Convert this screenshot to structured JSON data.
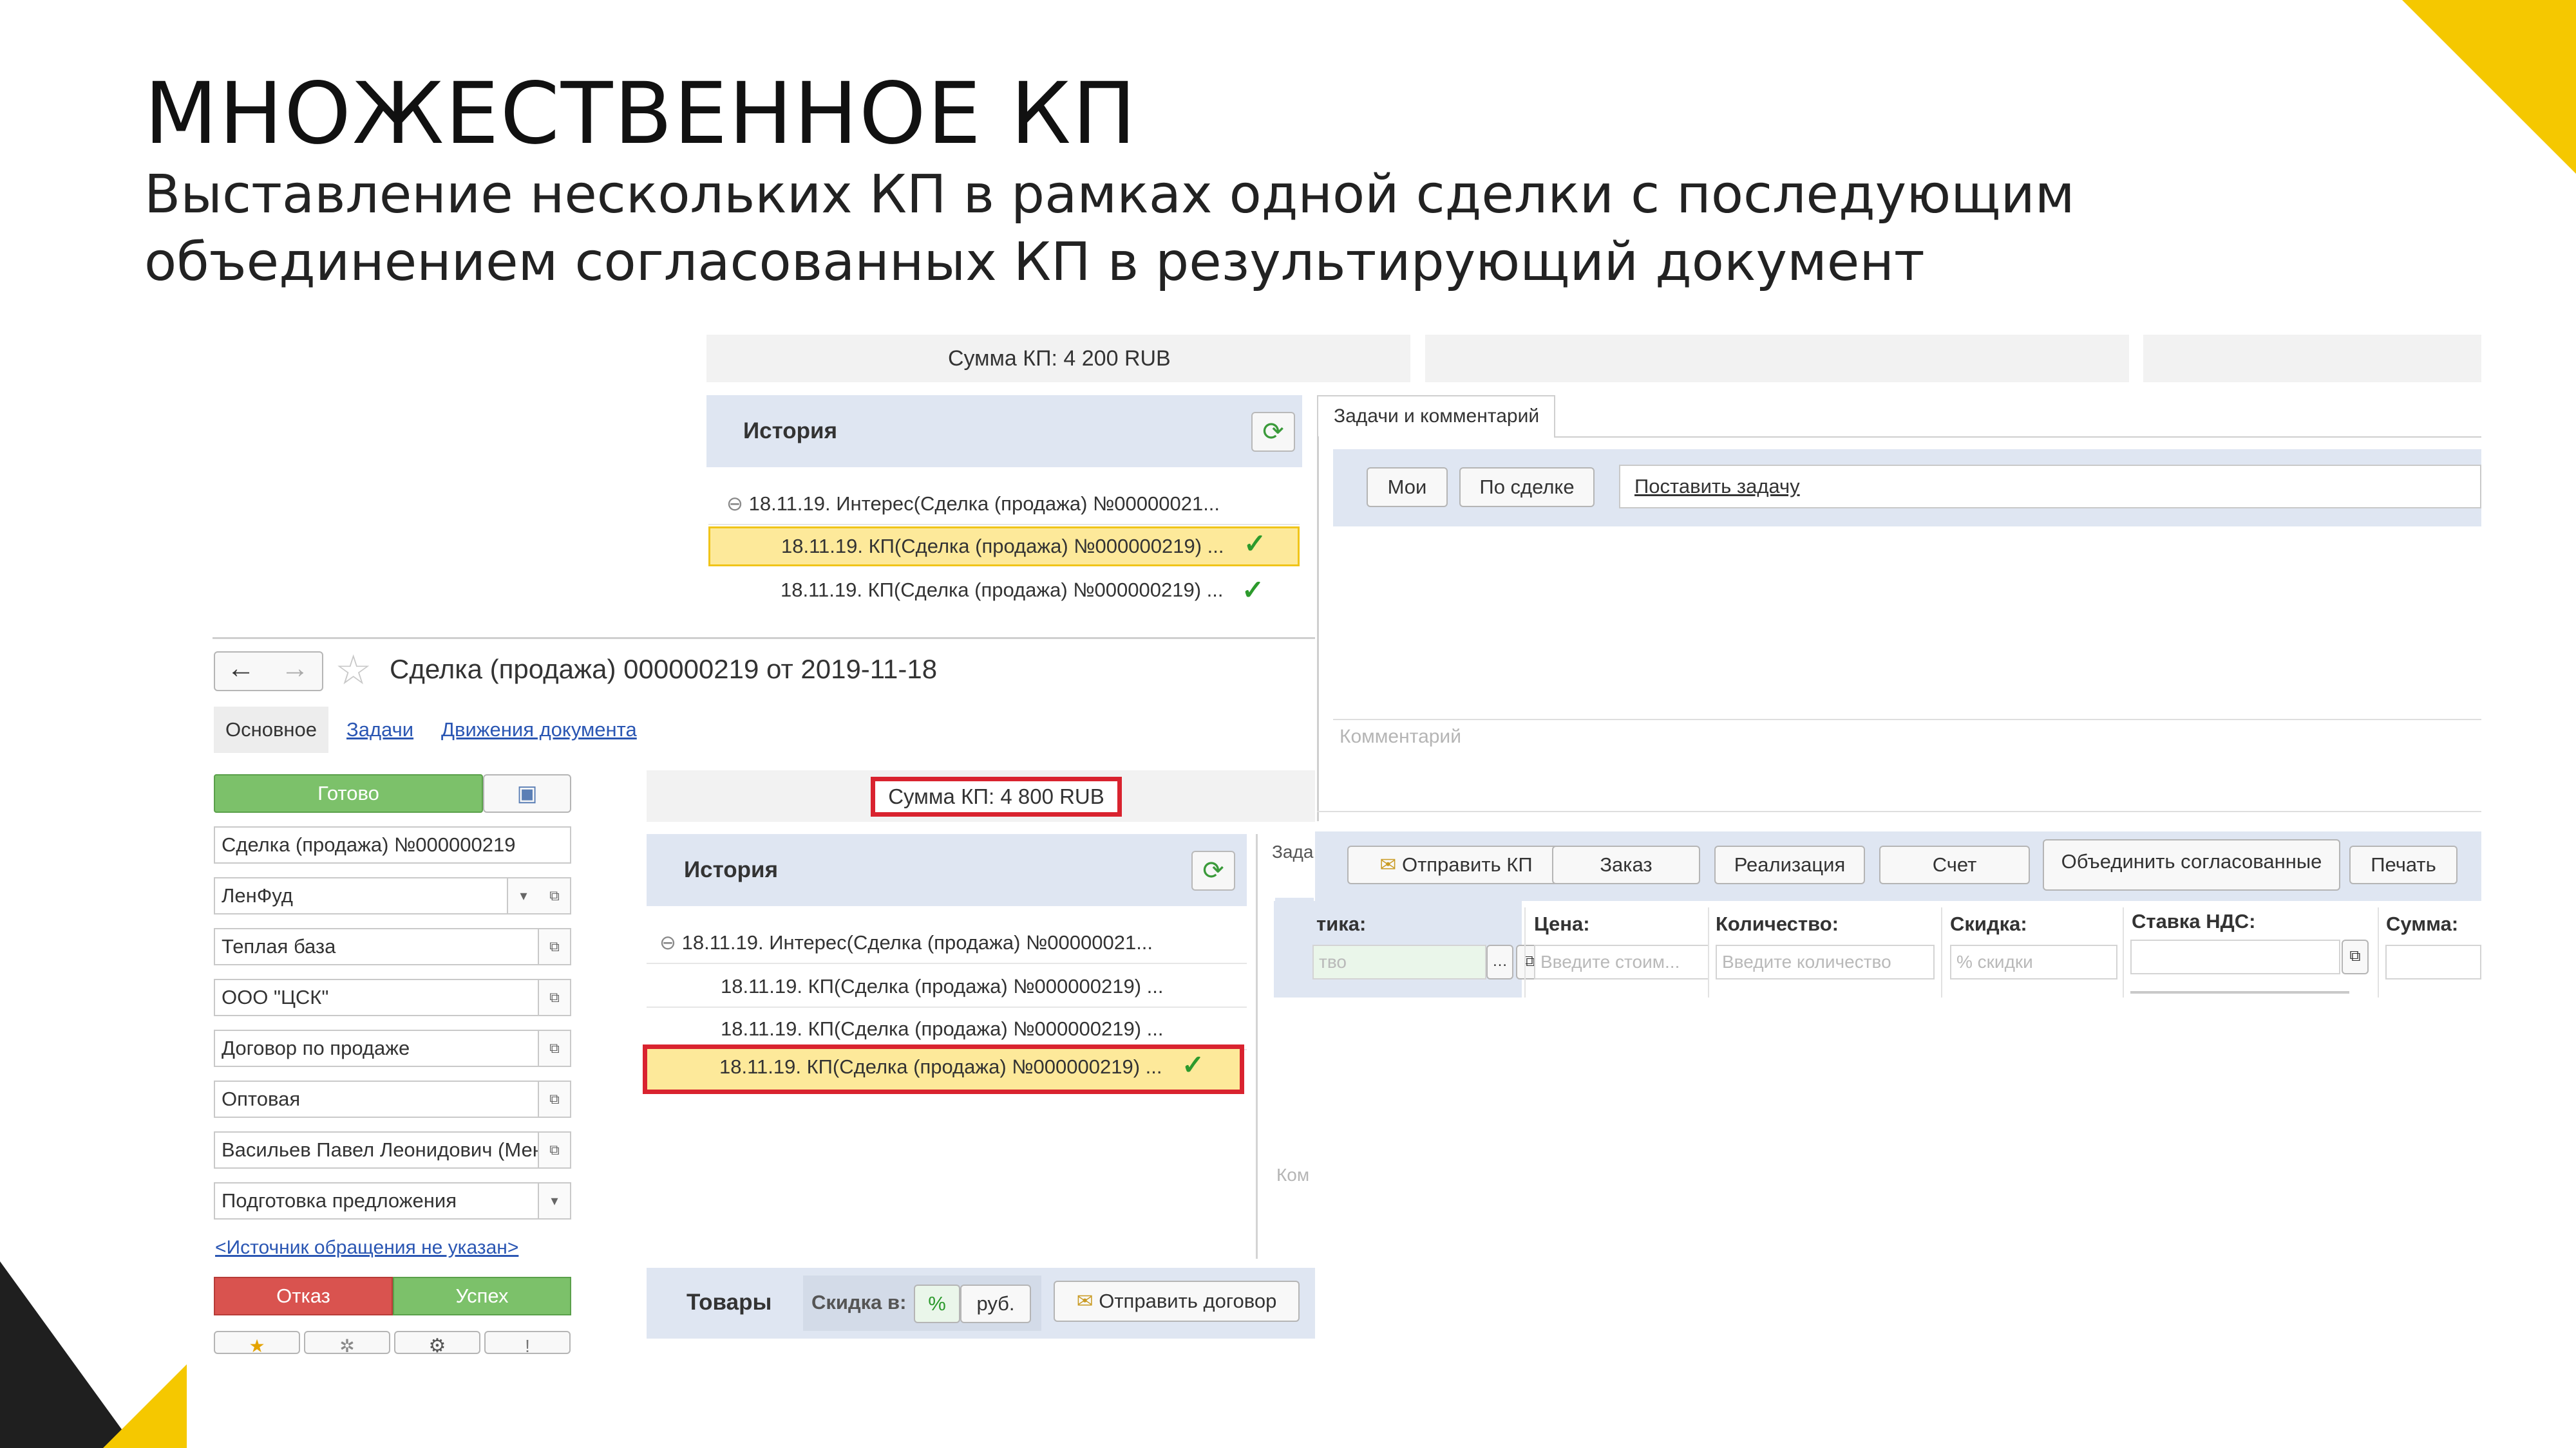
{
  "slide": {
    "title": "МНОЖЕСТВЕННОЕ КП",
    "subtitle": "Выставление нескольких КП в рамках одной сделки с последующим объединением согласованных КП в результирующий документ",
    "accent_color": "#f5c800",
    "dark_color": "#1f1f1f"
  },
  "top_screen": {
    "summa_kp": "Сумма КП: 4 200 RUB",
    "history_title": "История",
    "history_rows": [
      "18.11.19. Интерес(Сделка (продажа) №00000021...",
      "18.11.19. КП(Сделка (продажа) №000000219) ...",
      "18.11.19. КП(Сделка (продажа) №000000219) ..."
    ],
    "tasks_tab": "Задачи и комментарий",
    "btn_my": "Мои",
    "btn_by_deal": "По сделке",
    "set_task": "Поставить задачу",
    "comment_placeholder": "Комментарий"
  },
  "deal_form": {
    "title": "Сделка (продажа) 000000219 от 2019-11-18",
    "tabs": [
      "Основное",
      "Задачи",
      "Движения документа"
    ],
    "btn_ready": "Готово",
    "fields": [
      "Сделка (продажа) №000000219",
      "ЛенФуд",
      "Теплая база",
      "ООО \"ЦСК\"",
      "Договор по продаже",
      "Оптовая",
      "Васильев Павел Леонидович (Менеджер)",
      "Подготовка предложения"
    ],
    "source_link": "<Источник обращения не указан>",
    "btn_refuse": "Отказ",
    "btn_success": "Успех",
    "summa_kp": "Сумма КП: 4 800 RUB",
    "history_title": "История",
    "history_rows": [
      "18.11.19. Интерес(Сделка (продажа) №00000021...",
      "18.11.19. КП(Сделка (продажа) №000000219) ...",
      "18.11.19. КП(Сделка (продажа) №000000219) ...",
      "18.11.19. КП(Сделка (продажа) №000000219) ..."
    ],
    "side_tab_fragment": "Зада",
    "comment_fragment": "Ком",
    "goods_label": "Товары",
    "discount_label": "Скидка в:",
    "discount_percent": "%",
    "discount_rub": "руб.",
    "btn_send_contract": "Отправить договор"
  },
  "action_bar": {
    "btn_send_kp": "Отправить КП",
    "btn_order": "Заказ",
    "btn_realization": "Реализация",
    "btn_invoice": "Счет",
    "btn_merge": "Объединить согласованные",
    "btn_print": "Печать"
  },
  "goods_table": {
    "headers": [
      "тика:",
      "Цена:",
      "Количество:",
      "Скидка:",
      "Ставка НДС:",
      "Сумма:"
    ],
    "placeholders": [
      "тво",
      "Введите стоим...",
      "Введите количество",
      "% скидки",
      "",
      ""
    ]
  }
}
